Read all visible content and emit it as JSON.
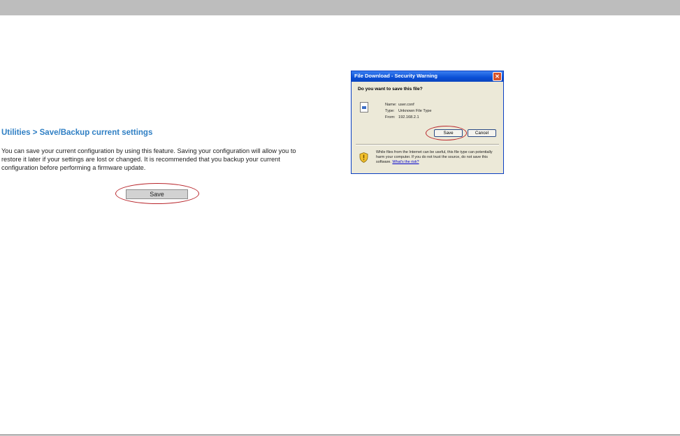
{
  "page": {
    "heading": "Utilities > Save/Backup current settings",
    "description": "You can save your current configuration by using this feature. Saving your configuration will allow you to restore it later if your settings are lost or changed. It is recommended that you backup your current configuration before performing a firmware update.",
    "save_label": "Save"
  },
  "dialog": {
    "title": "File Download - Security Warning",
    "close_glyph": "✕",
    "question": "Do you want to save this file?",
    "name_label": "Name:",
    "name_value": "user.conf",
    "type_label": "Type:",
    "type_value": "Unknown File Type",
    "from_label": "From:",
    "from_value": "192.168.2.1",
    "save_label": "Save",
    "cancel_label": "Cancel",
    "warning_text": "While files from the Internet can be useful, this file type can potentially harm your computer. If you do not trust the source, do not save this software.",
    "warning_link": "What's the risk?"
  },
  "colors": {
    "top_bar": "#bdbdbd",
    "heading": "#2f7fc4",
    "highlight_ring": "#b8252b",
    "dialog_title_bar": "#0a4fd6",
    "dialog_body": "#ece9d8"
  },
  "icons": [
    "file-icon",
    "shield-warning-icon",
    "close-icon"
  ]
}
